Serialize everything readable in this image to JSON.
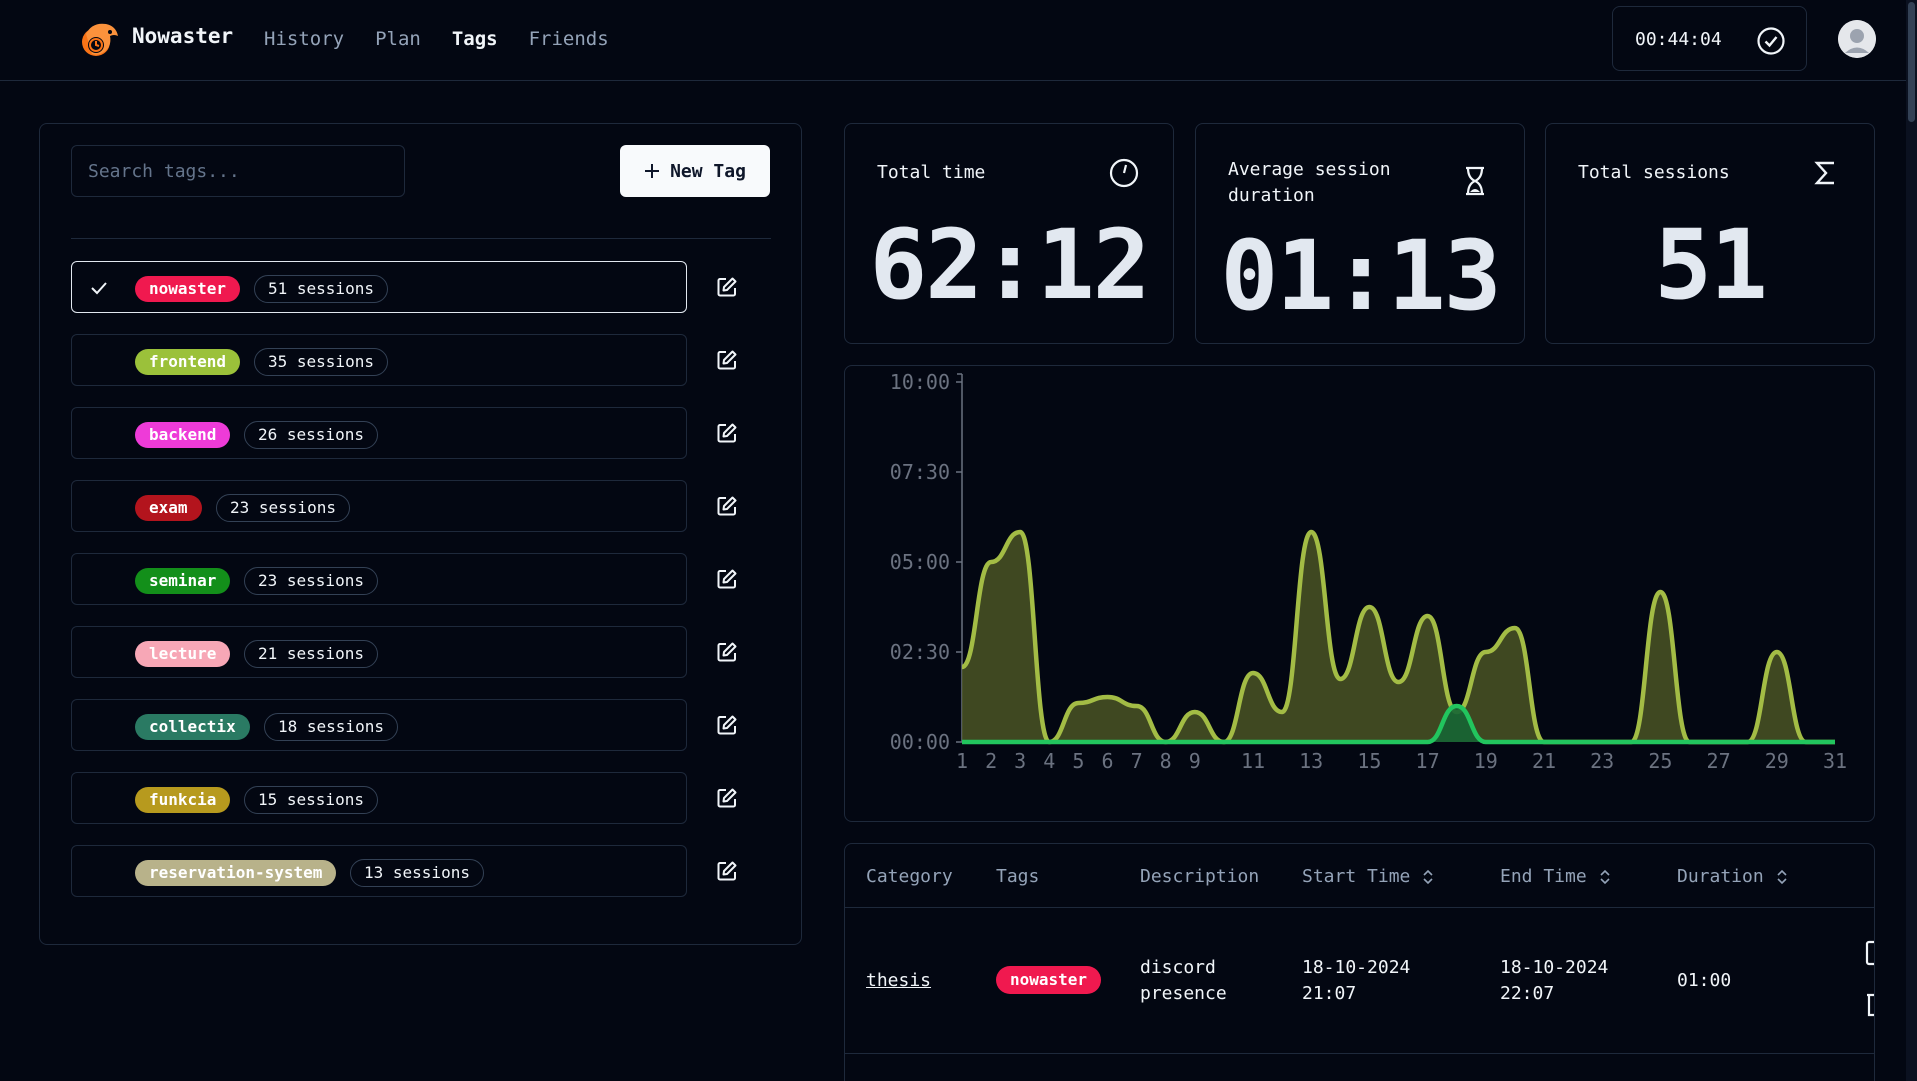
{
  "header": {
    "brand": "Nowaster",
    "nav": [
      {
        "label": "History",
        "active": false
      },
      {
        "label": "Plan",
        "active": false
      },
      {
        "label": "Tags",
        "active": true
      },
      {
        "label": "Friends",
        "active": false
      }
    ],
    "timer": "00:44:04"
  },
  "tags_panel": {
    "search_placeholder": "Search tags...",
    "new_tag_label": "New Tag",
    "tags": [
      {
        "name": "nowaster",
        "count": "51 sessions",
        "color": "#f0194f",
        "text": "#ffffff",
        "selected": true
      },
      {
        "name": "frontend",
        "count": "35 sessions",
        "color": "#9bc13a",
        "text": "#ffffff",
        "selected": false
      },
      {
        "name": "backend",
        "count": "26 sessions",
        "color": "#ee3bd8",
        "text": "#ffffff",
        "selected": false
      },
      {
        "name": "exam",
        "count": "23 sessions",
        "color": "#b3141d",
        "text": "#ffffff",
        "selected": false
      },
      {
        "name": "seminar",
        "count": "23 sessions",
        "color": "#138f1a",
        "text": "#ffffff",
        "selected": false
      },
      {
        "name": "lecture",
        "count": "21 sessions",
        "color": "#f7a7b6",
        "text": "#ffffff",
        "selected": false
      },
      {
        "name": "collectix",
        "count": "18 sessions",
        "color": "#2a7a63",
        "text": "#ffffff",
        "selected": false
      },
      {
        "name": "funkcia",
        "count": "15 sessions",
        "color": "#b79a1e",
        "text": "#ffffff",
        "selected": false
      },
      {
        "name": "reservation-system",
        "count": "13 sessions",
        "color": "#b8b28a",
        "text": "#ffffff",
        "selected": false
      }
    ]
  },
  "stats": {
    "total_time_label": "Total time",
    "total_time_value": "62:12",
    "avg_label": "Average session duration",
    "avg_value": "01:13",
    "sessions_label": "Total sessions",
    "sessions_value": "51"
  },
  "chart_data": {
    "type": "area",
    "x": [
      1,
      2,
      3,
      4,
      5,
      6,
      7,
      8,
      9,
      10,
      11,
      12,
      13,
      14,
      15,
      16,
      17,
      18,
      19,
      20,
      21,
      22,
      23,
      24,
      25,
      26,
      27,
      28,
      29,
      30,
      31
    ],
    "xticks": [
      "1",
      "2",
      "3",
      "4",
      "5",
      "6",
      "7",
      "8",
      "9",
      "11",
      "13",
      "15",
      "17",
      "19",
      "21",
      "23",
      "25",
      "27",
      "29",
      "31"
    ],
    "yticks": [
      "00:00",
      "02:30",
      "05:00",
      "07:30",
      "10:00"
    ],
    "ylim": [
      0,
      600
    ],
    "series": [
      {
        "color": "#a3bc45",
        "values": [
          125,
          300,
          350,
          0,
          65,
          75,
          60,
          0,
          50,
          0,
          115,
          50,
          350,
          105,
          225,
          100,
          210,
          50,
          150,
          190,
          0,
          0,
          0,
          0,
          250,
          0,
          0,
          0,
          150,
          0,
          0
        ]
      },
      {
        "color": "#22c55e",
        "values": [
          0,
          0,
          0,
          0,
          0,
          0,
          0,
          0,
          0,
          0,
          0,
          0,
          0,
          0,
          0,
          0,
          0,
          60,
          0,
          0,
          0,
          0,
          0,
          0,
          0,
          0,
          0,
          0,
          0,
          0,
          0
        ]
      }
    ],
    "grid": false
  },
  "table": {
    "headers": [
      "Category",
      "Tags",
      "Description",
      "Start Time",
      "End Time",
      "Duration"
    ],
    "rows": [
      {
        "category": "thesis",
        "tag": "nowaster",
        "tag_color": "#f0194f",
        "desc1": "discord",
        "desc2": "presence",
        "start1": "18-10-2024",
        "start2": "21:07",
        "end1": "18-10-2024",
        "end2": "22:07",
        "duration": "01:00"
      }
    ]
  }
}
